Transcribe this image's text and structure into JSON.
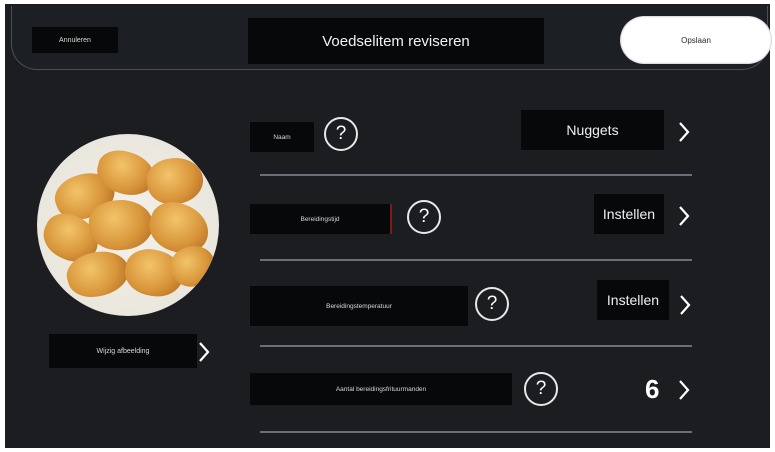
{
  "header": {
    "cancel_label": "Annuleren",
    "title": "Voedselitem reviseren",
    "save_label": "Opslaan"
  },
  "image": {
    "change_label": "Wijzig afbeelding",
    "description_icon": "chicken-nuggets-photo"
  },
  "rows": [
    {
      "label": "Naam",
      "value": "Nuggets"
    },
    {
      "label": "Bereidingstijd",
      "value": "Instellen"
    },
    {
      "label": "Bereidingstemperatuur",
      "value": "Instellen"
    },
    {
      "label": "Aantal bereidingsfrituurmanden",
      "value": "6"
    }
  ],
  "icons": {
    "help": "?",
    "chevron": "chevron-right-icon"
  },
  "colors": {
    "background": "#1b1d21",
    "label_background": "#070809",
    "save_button": "#ffffff",
    "divider": "#6a7079"
  }
}
